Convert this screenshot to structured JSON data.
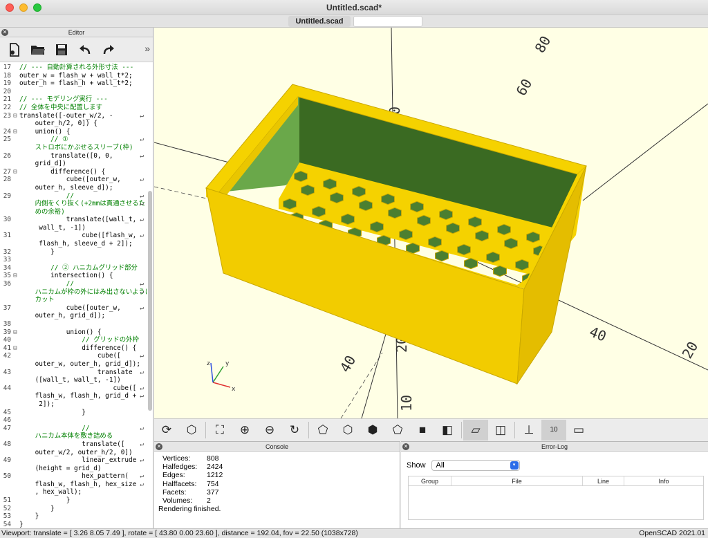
{
  "window": {
    "title": "Untitled.scad*",
    "tab": "Untitled.scad"
  },
  "editor": {
    "header": "Editor",
    "toolbar_icons": [
      "new-file-icon",
      "open-folder-icon",
      "save-icon",
      "undo-icon",
      "redo-icon"
    ],
    "more": "»",
    "lines": [
      {
        "n": "17",
        "f": "",
        "t": "// --- 自動計算される外形寸法 ---",
        "c": "cm"
      },
      {
        "n": "18",
        "f": "",
        "t": "outer_w = flash_w + wall_t*2;",
        "c": ""
      },
      {
        "n": "19",
        "f": "",
        "t": "outer_h = flash_h + wall_t*2;",
        "c": ""
      },
      {
        "n": "20",
        "f": "",
        "t": "",
        "c": ""
      },
      {
        "n": "21",
        "f": "",
        "t": "// --- モデリング実行 ---",
        "c": "cm"
      },
      {
        "n": "22",
        "f": "",
        "t": "// 全体を中央に配置します",
        "c": "cm"
      },
      {
        "n": "23",
        "f": "⊟",
        "t": "translate([-outer_w/2, -",
        "c": "",
        "w": true
      },
      {
        "n": "",
        "f": "",
        "t": "    outer_h/2, 0]) {",
        "c": ""
      },
      {
        "n": "24",
        "f": "⊟",
        "t": "    union() {",
        "c": ""
      },
      {
        "n": "25",
        "f": "",
        "t": "        // ①",
        "c": "cm",
        "w": true
      },
      {
        "n": "",
        "f": "",
        "t": "    ストロボにかぶせるスリーブ(枠)",
        "c": "cm"
      },
      {
        "n": "26",
        "f": "",
        "t": "        translate([0, 0,",
        "c": "",
        "w": true
      },
      {
        "n": "",
        "f": "",
        "t": "    grid_d])",
        "c": ""
      },
      {
        "n": "27",
        "f": "⊟",
        "t": "        difference() {",
        "c": ""
      },
      {
        "n": "28",
        "f": "",
        "t": "            cube([outer_w,",
        "c": "",
        "w": true
      },
      {
        "n": "",
        "f": "",
        "t": "    outer_h, sleeve_d]);",
        "c": ""
      },
      {
        "n": "29",
        "f": "",
        "t": "            //",
        "c": "cm",
        "w": true
      },
      {
        "n": "",
        "f": "",
        "t": "    内側をくり抜く(+2mmは貫通させるた",
        "c": "cm",
        "w": true
      },
      {
        "n": "",
        "f": "",
        "t": "    めの余裕)",
        "c": "cm"
      },
      {
        "n": "30",
        "f": "",
        "t": "            translate([wall_t,",
        "c": "",
        "w": true
      },
      {
        "n": "",
        "f": "",
        "t": "     wall_t, -1])",
        "c": ""
      },
      {
        "n": "31",
        "f": "",
        "t": "                cube([flash_w,",
        "c": "",
        "w": true
      },
      {
        "n": "",
        "f": "",
        "t": "     flash_h, sleeve_d + 2]);",
        "c": ""
      },
      {
        "n": "32",
        "f": "",
        "t": "        }",
        "c": ""
      },
      {
        "n": "33",
        "f": "",
        "t": "",
        "c": ""
      },
      {
        "n": "34",
        "f": "",
        "t": "        // ② ハニカムグリッド部分",
        "c": "cm"
      },
      {
        "n": "35",
        "f": "⊟",
        "t": "        intersection() {",
        "c": ""
      },
      {
        "n": "36",
        "f": "",
        "t": "            //",
        "c": "cm",
        "w": true
      },
      {
        "n": "",
        "f": "",
        "t": "    ハニカムが枠の外にはみ出さないように",
        "c": "cm",
        "w": true
      },
      {
        "n": "",
        "f": "",
        "t": "    カット",
        "c": "cm"
      },
      {
        "n": "37",
        "f": "",
        "t": "            cube([outer_w,",
        "c": "",
        "w": true
      },
      {
        "n": "",
        "f": "",
        "t": "    outer_h, grid_d]);",
        "c": ""
      },
      {
        "n": "38",
        "f": "",
        "t": "",
        "c": ""
      },
      {
        "n": "39",
        "f": "⊟",
        "t": "            union() {",
        "c": ""
      },
      {
        "n": "40",
        "f": "",
        "t": "                // グリッドの外枠",
        "c": "cm"
      },
      {
        "n": "41",
        "f": "⊟",
        "t": "                difference() {",
        "c": ""
      },
      {
        "n": "42",
        "f": "",
        "t": "                    cube([",
        "c": "",
        "w": true
      },
      {
        "n": "",
        "f": "",
        "t": "    outer_w, outer_h, grid_d]);",
        "c": ""
      },
      {
        "n": "43",
        "f": "",
        "t": "                    translate",
        "c": "",
        "w": true
      },
      {
        "n": "",
        "f": "",
        "t": "    ([wall_t, wall_t, -1])",
        "c": ""
      },
      {
        "n": "44",
        "f": "",
        "t": "                        cube([",
        "c": "",
        "w": true
      },
      {
        "n": "",
        "f": "",
        "t": "    flash_w, flash_h, grid_d +",
        "c": "",
        "w": true
      },
      {
        "n": "",
        "f": "",
        "t": "     2]);",
        "c": ""
      },
      {
        "n": "45",
        "f": "",
        "t": "                }",
        "c": ""
      },
      {
        "n": "46",
        "f": "",
        "t": "",
        "c": ""
      },
      {
        "n": "47",
        "f": "",
        "t": "                //",
        "c": "cm",
        "w": true
      },
      {
        "n": "",
        "f": "",
        "t": "    ハニカム本体を敷き詰める",
        "c": "cm"
      },
      {
        "n": "48",
        "f": "",
        "t": "                translate([",
        "c": "",
        "w": true
      },
      {
        "n": "",
        "f": "",
        "t": "    outer_w/2, outer_h/2, 0])",
        "c": ""
      },
      {
        "n": "49",
        "f": "",
        "t": "                linear_extrude",
        "c": "",
        "w": true
      },
      {
        "n": "",
        "f": "",
        "t": "    (height = grid_d)",
        "c": ""
      },
      {
        "n": "50",
        "f": "",
        "t": "                hex_pattern(",
        "c": "",
        "w": true
      },
      {
        "n": "",
        "f": "",
        "t": "    flash_w, flash_h, hex_size",
        "c": "",
        "w": true
      },
      {
        "n": "",
        "f": "",
        "t": "    , hex_wall);",
        "c": ""
      },
      {
        "n": "51",
        "f": "",
        "t": "            }",
        "c": ""
      },
      {
        "n": "52",
        "f": "",
        "t": "        }",
        "c": ""
      },
      {
        "n": "53",
        "f": "",
        "t": "    }",
        "c": ""
      },
      {
        "n": "54",
        "f": "",
        "t": "}",
        "c": ""
      }
    ]
  },
  "viewport": {
    "axis_labels": [
      "80",
      "60",
      "40",
      "20",
      "20",
      "40",
      "10",
      "20",
      "20",
      "10"
    ],
    "axis_marker": "10",
    "colors": {
      "background": "#ffffe5",
      "model_face": "#f5d200",
      "model_inner": "#5b9a3a"
    }
  },
  "view_toolbar": {
    "icons": [
      "animate-icon",
      "render-icon",
      "zoom-all-icon",
      "zoom-in-icon",
      "zoom-out-icon",
      "reset-view-icon",
      "view-right-icon",
      "view-top-icon",
      "view-bottom-icon",
      "view-left-icon",
      "view-front-icon",
      "view-back-icon",
      "perspective-icon",
      "orthogonal-icon",
      "show-axes-icon",
      "show-scale-icon",
      "show-edges-icon"
    ]
  },
  "console": {
    "header": "Console",
    "stats": [
      {
        "label": "Vertices:",
        "value": "808"
      },
      {
        "label": "Halfedges:",
        "value": "2424"
      },
      {
        "label": "Edges:",
        "value": "1212"
      },
      {
        "label": "Halffacets:",
        "value": "754"
      },
      {
        "label": "Facets:",
        "value": "377"
      },
      {
        "label": "Volumes:",
        "value": "2"
      }
    ],
    "finished": "Rendering finished."
  },
  "error_log": {
    "header": "Error-Log",
    "show_label": "Show",
    "show_value": "All",
    "columns": [
      "Group",
      "File",
      "Line",
      "Info"
    ]
  },
  "status": {
    "viewport": "Viewport: translate = [ 3.26 8.05 7.49 ], rotate = [ 43.80 0.00 23.60 ], distance = 192.04, fov = 22.50 (1038x728)",
    "version": "OpenSCAD 2021.01"
  }
}
